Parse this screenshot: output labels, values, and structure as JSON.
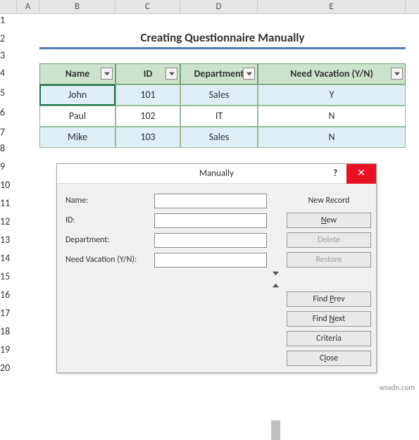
{
  "columns": [
    "",
    "A",
    "B",
    "C",
    "D",
    "E"
  ],
  "rows": [
    "1",
    "2",
    "3",
    "4",
    "5",
    "6",
    "7",
    "8",
    "9",
    "10",
    "11",
    "12",
    "13",
    "14",
    "15",
    "16",
    "17",
    "18",
    "19",
    "20"
  ],
  "title": "Creating Questionnaire Manually",
  "headers": {
    "name": "Name",
    "id": "ID",
    "dept": "Department",
    "vac": "Need Vacation (Y/N)"
  },
  "data_rows": [
    {
      "name": "John",
      "id": "101",
      "dept": "Sales",
      "vac": "Y"
    },
    {
      "name": "Paul",
      "id": "102",
      "dept": "IT",
      "vac": "N"
    },
    {
      "name": "Mike",
      "id": "103",
      "dept": "Sales",
      "vac": "N"
    }
  ],
  "chart_data": {
    "type": "table",
    "columns": [
      "Name",
      "ID",
      "Department",
      "Need Vacation (Y/N)"
    ],
    "rows": [
      [
        "John",
        101,
        "Sales",
        "Y"
      ],
      [
        "Paul",
        102,
        "IT",
        "N"
      ],
      [
        "Mike",
        103,
        "Sales",
        "N"
      ]
    ],
    "title": "Creating Questionnaire Manually"
  },
  "dialog": {
    "title": "Manually",
    "labels": {
      "name": "Name:",
      "id": "ID:",
      "dept": "Department:",
      "vac": "Need Vacation (Y/N):"
    },
    "record": "New Record",
    "buttons": {
      "new": "New",
      "delete": "Delete",
      "restore": "Restore",
      "findprev": "Find Prev",
      "findnext": "Find Next",
      "criteria": "Criteria",
      "close": "Close"
    }
  },
  "watermark": "wsxdn.com"
}
